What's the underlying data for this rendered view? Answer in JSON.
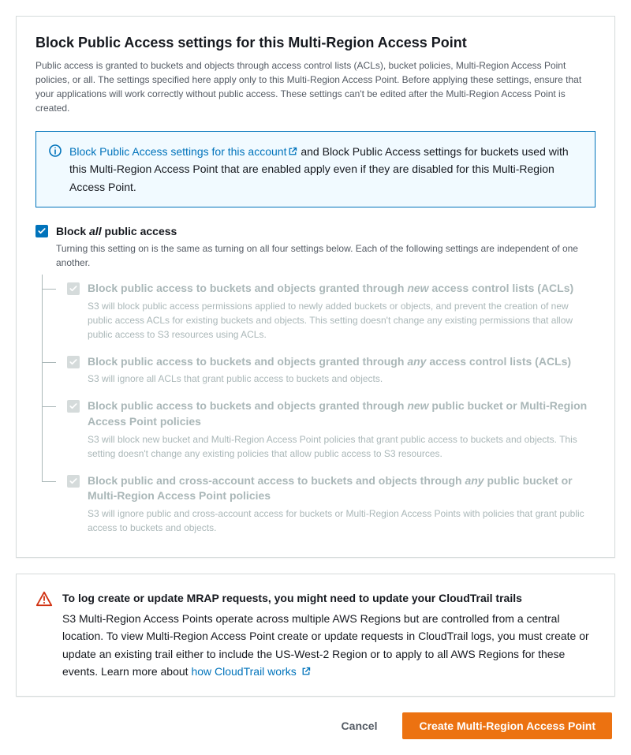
{
  "panel": {
    "title": "Block Public Access settings for this Multi-Region Access Point",
    "desc": "Public access is granted to buckets and objects through access control lists (ACLs), bucket policies, Multi-Region Access Point policies, or all. The settings specified here apply only to this Multi-Region Access Point. Before applying these settings, ensure that your applications will work correctly without public access. These settings can't be edited after the Multi-Region Access Point is created."
  },
  "info": {
    "link_text": "Block Public Access settings for this account",
    "text_after": " and Block Public Access settings for buckets used with this Multi-Region Access Point that are enabled apply even if they are disabled for this Multi-Region Access Point."
  },
  "block_all": {
    "label_prefix": "Block ",
    "label_italic": "all",
    "label_suffix": " public access",
    "desc": "Turning this setting on is the same as turning on all four settings below. Each of the following settings are independent of one another."
  },
  "sub": [
    {
      "label_prefix": "Block public access to buckets and objects granted through ",
      "label_italic": "new",
      "label_suffix": " access control lists (ACLs)",
      "desc": "S3 will block public access permissions applied to newly added buckets or objects, and prevent the creation of new public access ACLs for existing buckets and objects. This setting doesn't change any existing permissions that allow public access to S3 resources using ACLs."
    },
    {
      "label_prefix": "Block public access to buckets and objects granted through ",
      "label_italic": "any",
      "label_suffix": " access control lists (ACLs)",
      "desc": "S3 will ignore all ACLs that grant public access to buckets and objects."
    },
    {
      "label_prefix": "Block public access to buckets and objects granted through ",
      "label_italic": "new",
      "label_suffix": " public bucket or Multi-Region Access Point policies",
      "desc": "S3 will block new bucket and Multi-Region Access Point policies that grant public access to buckets and objects. This setting doesn't change any existing policies that allow public access to S3 resources."
    },
    {
      "label_prefix": "Block public and cross-account access to buckets and objects through ",
      "label_italic": "any",
      "label_suffix": " public bucket or Multi-Region Access Point policies",
      "desc": "S3 will ignore public and cross-account access for buckets or Multi-Region Access Points with policies that grant public access to buckets and objects."
    }
  ],
  "warn": {
    "title": "To log create or update MRAP requests, you might need to update your CloudTrail trails",
    "text_before": "S3 Multi-Region Access Points operate across multiple AWS Regions but are controlled from a central location. To view Multi-Region Access Point create or update requests in CloudTrail logs, you must create or update an existing trail either to include the US-West-2 Region or to apply to all AWS Regions for these events. Learn more about ",
    "link_text": "how CloudTrail works"
  },
  "buttons": {
    "cancel": "Cancel",
    "create": "Create Multi-Region Access Point"
  }
}
